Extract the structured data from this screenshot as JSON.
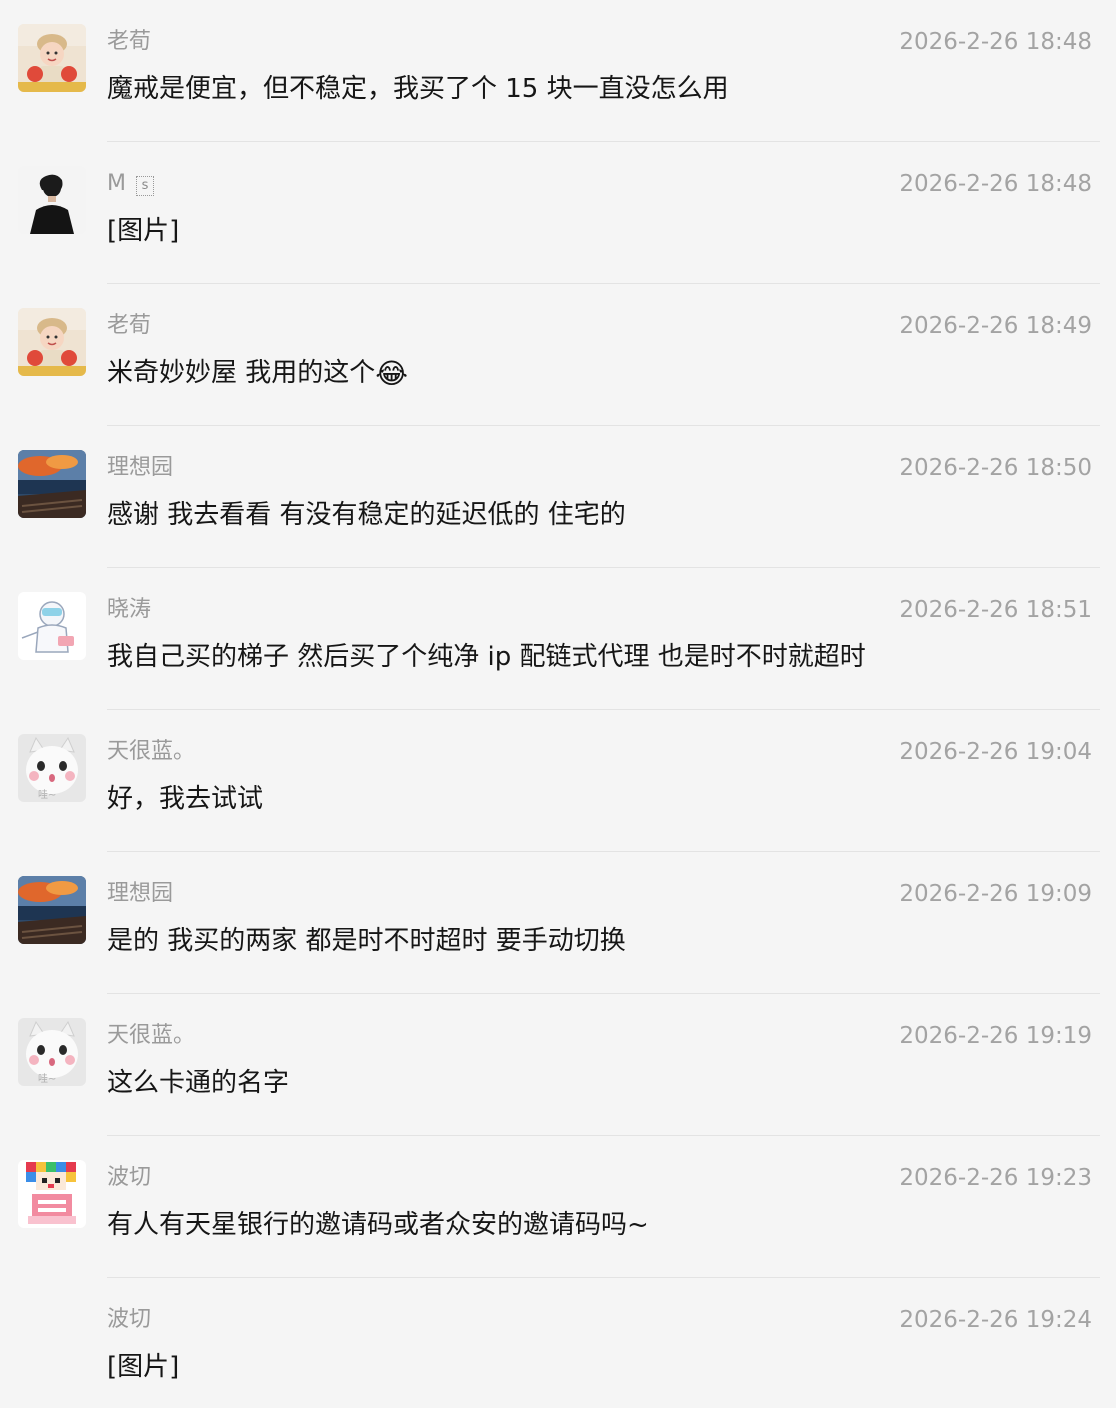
{
  "messages": [
    {
      "sender": "老荀",
      "time": "2026-2-26 18:48",
      "text": "魔戒是便宜，但不稳定，我买了个 15 块一直没怎么用",
      "avatar": "girl-avatar"
    },
    {
      "sender": "M",
      "sender_tag": "s",
      "time": "2026-2-26 18:48",
      "text": "[图片]",
      "avatar": "silhouette-avatar"
    },
    {
      "sender": "老荀",
      "time": "2026-2-26 18:49",
      "text": "米奇妙妙屋 我用的这个",
      "emoji": "😂",
      "avatar": "girl-avatar"
    },
    {
      "sender": "理想园",
      "time": "2026-2-26 18:50",
      "text": "感谢 我去看看 有没有稳定的延迟低的 住宅的",
      "avatar": "landscape-avatar"
    },
    {
      "sender": "晓涛",
      "time": "2026-2-26 18:51",
      "text": "我自己买的梯子 然后买了个纯净 ip 配链式代理 也是时不时就超时",
      "avatar": "cartoon-avatar"
    },
    {
      "sender": "天很蓝。",
      "time": "2026-2-26 19:04",
      "text": "好，我去试试",
      "avatar": "cat-avatar",
      "avatar_caption": "哇~"
    },
    {
      "sender": "理想园",
      "time": "2026-2-26 19:09",
      "text": "是的 我买的两家 都是时不时超时 要手动切换",
      "avatar": "landscape-avatar"
    },
    {
      "sender": "天很蓝。",
      "time": "2026-2-26 19:19",
      "text": "这么卡通的名字",
      "avatar": "cat-avatar",
      "avatar_caption": "哇~"
    },
    {
      "sender": "波切",
      "time": "2026-2-26 19:23",
      "text": "有人有天星银行的邀请码或者众安的邀请码吗~",
      "avatar": "pixel-avatar"
    },
    {
      "sender": "波切",
      "time": "2026-2-26 19:24",
      "text": "[图片]",
      "avatar": "none"
    }
  ]
}
